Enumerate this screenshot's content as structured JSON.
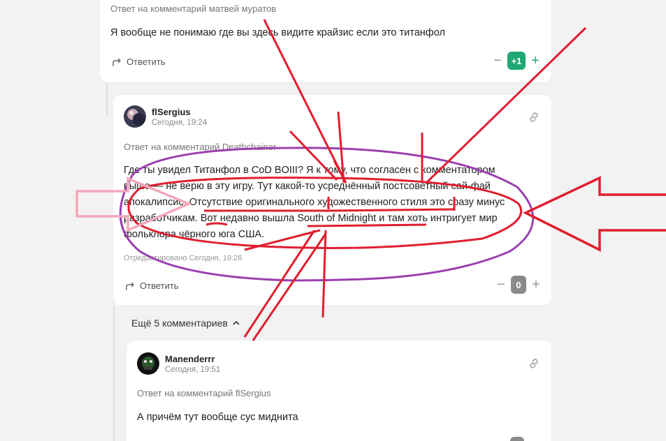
{
  "comment_top": {
    "reply_to": "Ответ на комментарий матвей муратов",
    "text": "Я вообще не понимаю где вы здесь видите крайзис если это титанфол",
    "reply_label": "Ответить",
    "score": "+1"
  },
  "comment_main": {
    "author": "flSergius",
    "time": "Сегодня, 19:24",
    "reply_to": "Ответ на комментарий Deathchainer",
    "lines": [
      "Где ты увидел Титанфол в CoD BOIII? Я к тому, что согласен с комментатором",
      "выше — не верю в эту игру. Тут какой-то усреднённый постсоветный сай-фай",
      "апокалипсис. Отсутствие оригинального художественного стиля это сразу минус",
      "разработчикам. Вот недавно вышла South of Midnight и там хоть интригует мир",
      "фольклора чёрного юга США."
    ],
    "edited": "Отредактировано Сегодня, 19:26",
    "reply_label": "Ответить",
    "score": "0"
  },
  "more_comments": {
    "label": "Ещё 5 комментариев"
  },
  "comment_bottom": {
    "author": "Manenderrr",
    "time": "Сегодня, 19:51",
    "reply_to": "Ответ на комментарий flSergius",
    "text": "А причём тут вообще сус миднита"
  },
  "icons": {
    "reply": "reply-arrow-icon",
    "link": "link-icon",
    "chevron": "chevron-up-icon"
  },
  "colors": {
    "score_positive": "#1fa873",
    "score_neutral": "#8a8a8a",
    "annotation_red": "#e01e2e",
    "annotation_purple": "#9b3fb0",
    "annotation_pink": "#f4a7b9"
  }
}
